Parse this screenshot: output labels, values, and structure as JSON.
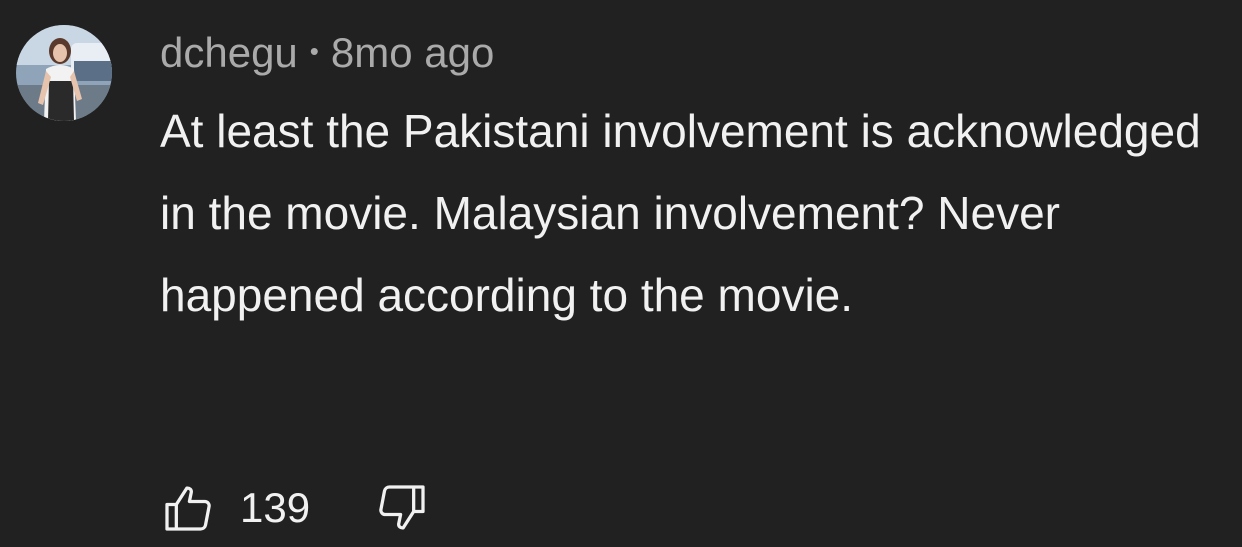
{
  "comment": {
    "author": "dchegu",
    "separator": "•",
    "time": "8mo ago",
    "text": "At least the Pakistani involvement is acknowledged in the movie. Malaysian involvement? Never happened according to the movie.",
    "like_count": "139"
  },
  "icons": {
    "like": "thumbs-up-icon",
    "dislike": "thumbs-down-icon"
  },
  "colors": {
    "background": "#212121",
    "primary_text": "#f1f1f1",
    "secondary_text": "#aaaaaa"
  }
}
